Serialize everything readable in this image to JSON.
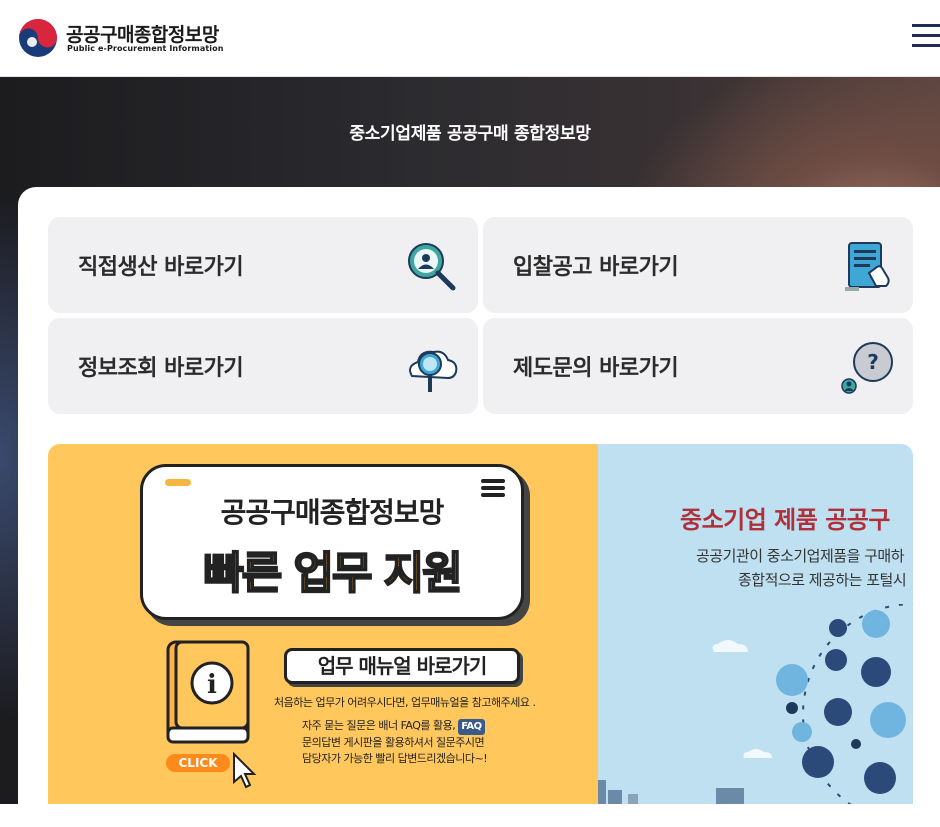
{
  "header": {
    "brand_ko": "공공구매종합정보망",
    "brand_en": "Public e-Procurement Information"
  },
  "hero": {
    "title": "중소기업제품 공공구매 종합정보망"
  },
  "quick_links": [
    {
      "label": "직접생산 바로가기",
      "icon": "person-search-icon"
    },
    {
      "label": "입찰공고 바로가기",
      "icon": "tablet-document-icon"
    },
    {
      "label": "정보조회 바로가기",
      "icon": "cloud-search-icon"
    },
    {
      "label": "제도문의 바로가기",
      "icon": "question-bubble-icon"
    }
  ],
  "banner_left": {
    "title": "공공구매종합정보망",
    "subtitle": "빠른 업무 지원",
    "manual_button": "업무 매뉴얼 바로가기",
    "line1": "처음하는 업무가 어려우시다면, 업무매뉴얼을 참고해주세요 .",
    "line2a": "자주 묻는 질문은 배너 FAQ를 활용,",
    "faq_tag": "FAQ",
    "line2b": "문의답변 게시판을 활용하셔서 질문주시면",
    "line2c": "담당자가 가능한 빨리 답변드리겠습니다~!",
    "click": "CLICK"
  },
  "banner_right": {
    "title": "중소기업 제품 공공구",
    "desc1": "공공기관이 중소기업제품을 구매하",
    "desc2": "종합적으로 제공하는 포털시"
  },
  "colors": {
    "header_menu": "#1f2a55",
    "banner_left_bg": "#ffc75c",
    "banner_right_bg": "#bfe0f1",
    "right_title": "#b0303a",
    "card_bg": "#f0f0f3"
  }
}
